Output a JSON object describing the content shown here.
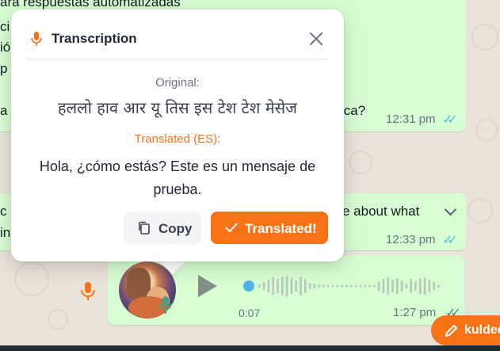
{
  "chat": {
    "message1": {
      "line1": "ara respuestas automatizadas",
      "line2": "ci",
      "line3": "ió",
      "line4": "p",
      "line5_start": "a",
      "line5_end": "ica?",
      "time": "12:31 pm"
    },
    "message2": {
      "line1_start": "c",
      "line1_end": "e about what",
      "line2": "in",
      "time": "12:33 pm"
    },
    "voice": {
      "duration": "0:07",
      "time": "1:27 pm"
    },
    "user_pill": {
      "label": "kuldee"
    }
  },
  "popup": {
    "title": "Transcription",
    "original_label": "Original:",
    "original_text": "हललो हाव आर यू तिस इस टेश टेश मेसेज",
    "translated_label": "Translated (ES):",
    "translated_text": "Hola, ¿cómo estás? Este es un mensaje de prueba.",
    "copy_label": "Copy",
    "translate_label": "Translated!"
  },
  "colors": {
    "accent": "#f97316",
    "bubble": "#d9fdd3",
    "read_ticks": "#53bdeb"
  },
  "icons": [
    "mic-icon",
    "close-icon",
    "copy-icon",
    "check-icon",
    "play-icon",
    "chevron-down-icon",
    "pencil-icon",
    "double-check-icon"
  ]
}
